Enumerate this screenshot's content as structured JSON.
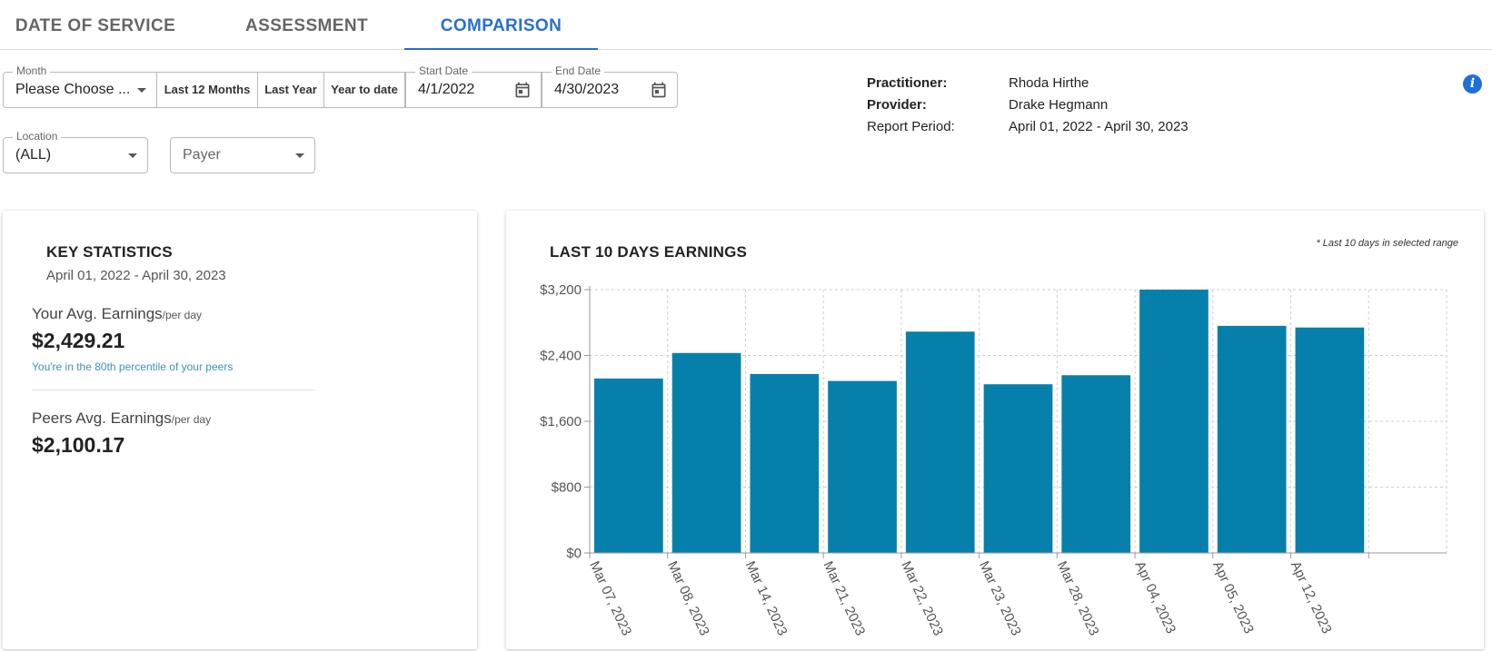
{
  "tabs": [
    {
      "label": "DATE OF SERVICE",
      "active": false
    },
    {
      "label": "ASSESSMENT",
      "active": false
    },
    {
      "label": "COMPARISON",
      "active": true
    }
  ],
  "filters": {
    "month": {
      "label": "Month",
      "value": "Please Choose ..."
    },
    "quick_buttons": [
      "Last 12 Months",
      "Last Year",
      "Year to date"
    ],
    "start_date": {
      "label": "Start Date",
      "value": "4/1/2022"
    },
    "end_date": {
      "label": "End Date",
      "value": "4/30/2023"
    },
    "location": {
      "label": "Location",
      "value": "(ALL)"
    },
    "payer": {
      "placeholder": "Payer"
    }
  },
  "info": {
    "practitioner_label": "Practitioner:",
    "practitioner": "Rhoda Hirthe",
    "provider_label": "Provider:",
    "provider": "Drake Hegmann",
    "report_period_label": "Report Period:",
    "report_period": "April 01, 2022 - April 30, 2023"
  },
  "key_stats": {
    "title": "KEY STATISTICS",
    "period": "April 01, 2022 - April 30, 2023",
    "your_label": "Your Avg. Earnings",
    "per_day": "/per day",
    "your_value": "$2,429.21",
    "percentile_note": "You're in the 80th percentile of your peers",
    "peers_label": "Peers Avg. Earnings",
    "peers_value": "$2,100.17"
  },
  "earnings_chart": {
    "title": "LAST 10 DAYS EARNINGS",
    "note": "* Last 10 days in selected range"
  },
  "colors": {
    "accent": "#2871c9",
    "bar": "#0680ab",
    "note": "#3f8fb8"
  },
  "chart_data": {
    "type": "bar",
    "title": "LAST 10 DAYS EARNINGS",
    "categories": [
      "Mar 07, 2023",
      "Mar 08, 2023",
      "Mar 14, 2023",
      "Mar 21, 2023",
      "Mar 22, 2023",
      "Mar 23, 2023",
      "Mar 28, 2023",
      "Apr 04, 2023",
      "Apr 05, 2023",
      "Apr 12, 2023",
      ""
    ],
    "values": [
      2120,
      2430,
      2175,
      2090,
      2690,
      2050,
      2160,
      3200,
      2760,
      2740
    ],
    "yticks": [
      "$0",
      "$800",
      "$1,600",
      "$2,400",
      "$3,200"
    ],
    "ytick_values": [
      0,
      800,
      1600,
      2400,
      3200
    ],
    "ylim": [
      0,
      3200
    ],
    "grid": true,
    "xlabel": "",
    "ylabel": ""
  }
}
